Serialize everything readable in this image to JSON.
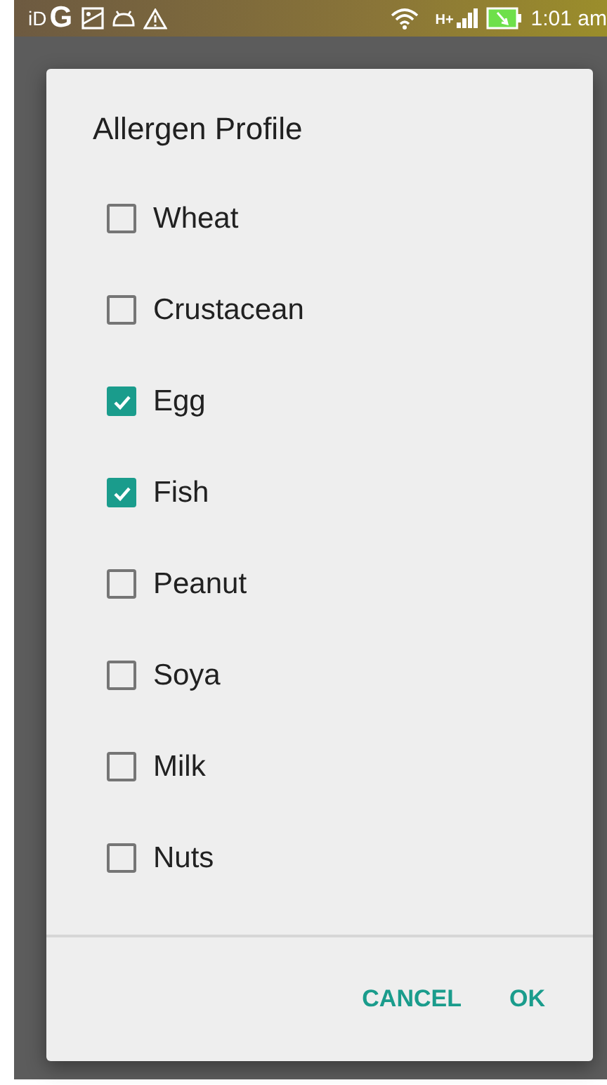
{
  "status_bar": {
    "left_texts": [
      "iD",
      "G"
    ],
    "network": "H+",
    "time": "1:01 am"
  },
  "dialog": {
    "title": "Allergen Profile",
    "options": [
      {
        "label": "Wheat",
        "checked": false
      },
      {
        "label": "Crustacean",
        "checked": false
      },
      {
        "label": "Egg",
        "checked": true
      },
      {
        "label": "Fish",
        "checked": true
      },
      {
        "label": "Peanut",
        "checked": false
      },
      {
        "label": "Soya",
        "checked": false
      },
      {
        "label": "Milk",
        "checked": false
      },
      {
        "label": "Nuts",
        "checked": false
      }
    ],
    "buttons": [
      "CANCEL",
      "OK"
    ]
  }
}
